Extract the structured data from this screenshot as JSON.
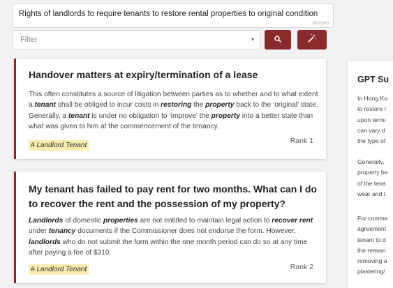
{
  "search": {
    "query": "Rights of landlords to require tenants to restore rental properties to original condition",
    "char_count": "89/2500",
    "filter_placeholder": "Filter"
  },
  "results": [
    {
      "title": "Handover matters at expiry/termination of a lease",
      "body_html": "This often constitutes a source of litigation between parties as to whether and to what extent a <b>tenant</b> shall be obliged to incur costs in <b>restoring</b> the <b>property</b> back to the ‘original’ state. Generally, a <b>tenant</b> is under no obligation to ‘improve’ the <b>property</b> into a better state than what was given to him at the commencement of the tenancy.",
      "tag": "# Landlord Tenant",
      "rank": "Rank 1"
    },
    {
      "title": "My tenant has failed to pay rent for two months. What can I do to recover the rent and the possession of my property?",
      "body_html": "<b>Landlords</b> of domestic <b>properties</b> are not entitled to maintain legal action to <b>recover rent</b> under <b>tenancy</b> documents if the Commissioner does not endorse the form. However, <b>landlords</b> who do not submit the form within the one month period can do so at any time after paying a fee of $310.",
      "tag": "# Landlord Tenant",
      "rank": "Rank 2"
    }
  ],
  "gpt": {
    "title": "GPT Su",
    "para1": [
      "In Hong Ko",
      "to restore r",
      "upon termi",
      "can vary d",
      "the type of"
    ],
    "para2": [
      "Generally, ",
      "property be",
      "of the tena",
      "wear and t"
    ],
    "para3": [
      "For comme",
      "agreement",
      "tenant to d",
      "the reason",
      "removing a",
      "plastering/"
    ]
  },
  "icons": {
    "search": "search-icon",
    "magic": "magic-wand-icon",
    "caret": "caret-down-icon"
  },
  "colors": {
    "accent": "#8b2a2a",
    "tag_bg": "#f6ecb0"
  }
}
